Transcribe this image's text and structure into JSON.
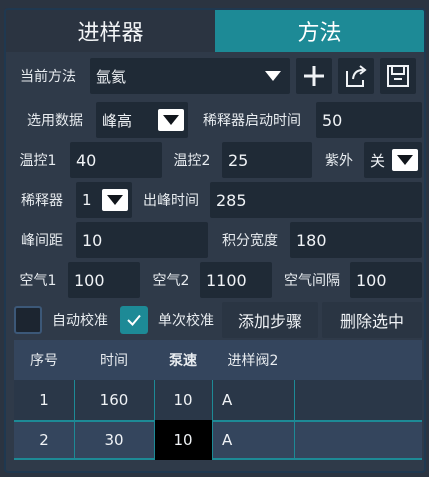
{
  "tabs": [
    {
      "label": "进样器",
      "active": false
    },
    {
      "label": "方法",
      "active": true
    }
  ],
  "method_row": {
    "label": "当前方法",
    "value": "氩氦"
  },
  "data_row": {
    "label": "选用数据",
    "value": "峰高",
    "dilutor_start_label": "稀释器启动时间",
    "dilutor_start_value": "50"
  },
  "temp_row": {
    "temp1_label": "温控1",
    "temp1_value": "40",
    "temp2_label": "温控2",
    "temp2_value": "25",
    "uv_label": "紫外",
    "uv_value": "关"
  },
  "dilutor_row": {
    "label": "稀释器",
    "value": "1",
    "peak_time_label": "出峰时间",
    "peak_time_value": "285"
  },
  "peak_row": {
    "spacing_label": "峰间距",
    "spacing_value": "10",
    "width_label": "积分宽度",
    "width_value": "180"
  },
  "air_row": {
    "air1_label": "空气1",
    "air1_value": "100",
    "air2_label": "空气2",
    "air2_value": "1100",
    "interval_label": "空气间隔",
    "interval_value": "100"
  },
  "options_row": {
    "auto_calib_label": "自动校准",
    "auto_calib_checked": false,
    "single_calib_label": "单次校准",
    "single_calib_checked": true,
    "add_step_label": "添加步骤",
    "delete_selected_label": "删除选中"
  },
  "steps_table": {
    "headers": [
      "序号",
      "时间",
      "泵速",
      "进样阀2"
    ],
    "rows": [
      [
        "1",
        "160",
        "10",
        "A"
      ],
      [
        "2",
        "30",
        "10",
        "A"
      ]
    ]
  },
  "colors": {
    "accent": "#1d8a96",
    "background": "#2f3a49",
    "field": "#1f2a36"
  }
}
